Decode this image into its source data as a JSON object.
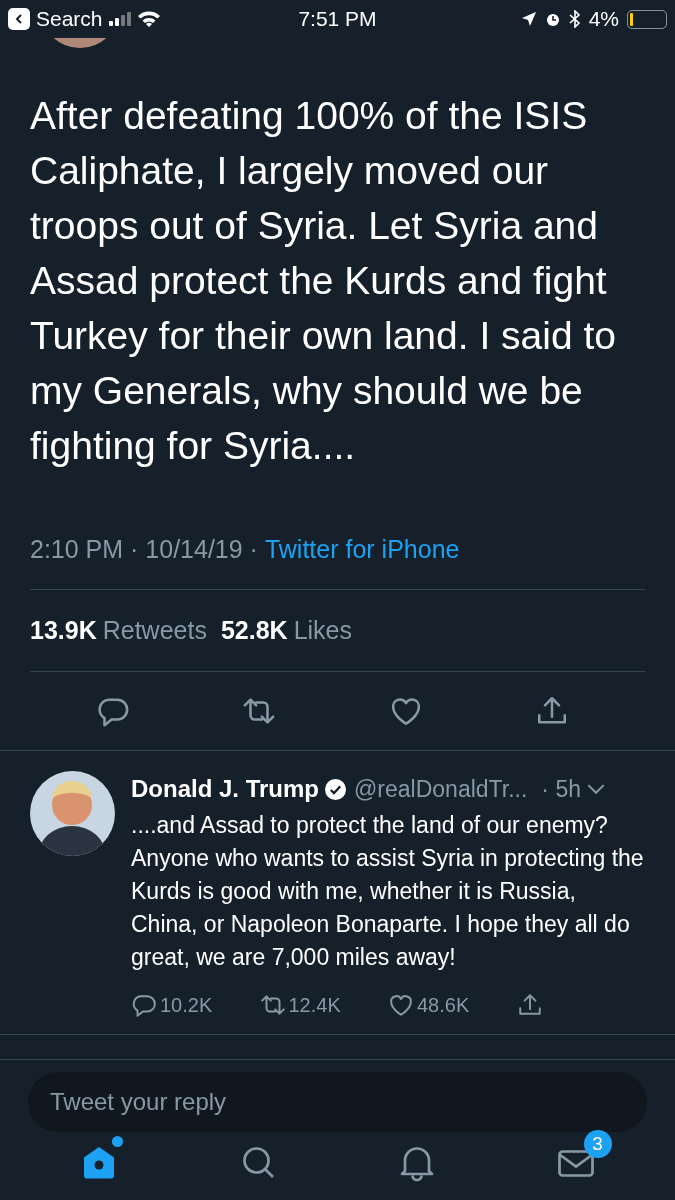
{
  "status_bar": {
    "back_label": "Search",
    "time": "7:51 PM",
    "battery": "4%"
  },
  "tweet": {
    "text": "After defeating 100% of the ISIS Caliphate, I largely moved our troops out of Syria. Let Syria and Assad protect the Kurds and fight Turkey for their own land. I said to my Generals, why should we be fighting for Syria....",
    "timestamp": "2:10 PM · 10/14/19 ·",
    "source": "Twitter for iPhone",
    "stats": [
      {
        "count": "13.9K",
        "label": "Retweets"
      },
      {
        "count": "52.8K",
        "label": "Likes"
      }
    ],
    "actions": [
      {
        "kind": "reply"
      },
      {
        "kind": "retweet"
      },
      {
        "kind": "like"
      },
      {
        "kind": "share"
      }
    ]
  },
  "reply": {
    "name": "Donald J. Trump",
    "verified": true,
    "handle": "@realDonaldTr...",
    "time": "· 5h",
    "text": "....and Assad to protect the land of our enemy? Anyone who wants to assist Syria in protecting the Kurds is good with me, whether it is Russia, China, or Napoleon Bonaparte. I hope they all do great, we are 7,000 miles away!",
    "actions": [
      {
        "kind": "reply",
        "count": "10.2K"
      },
      {
        "kind": "retweet",
        "count": "12.4K"
      },
      {
        "kind": "like",
        "count": "48.6K"
      },
      {
        "kind": "share"
      }
    ]
  },
  "composer": {
    "placeholder": "Tweet your reply"
  },
  "tabs": [
    {
      "kind": "home",
      "selected": true,
      "new_dot": true
    },
    {
      "kind": "search",
      "selected": false
    },
    {
      "kind": "notifications",
      "selected": false
    },
    {
      "kind": "messages",
      "selected": false,
      "badge": "3"
    }
  ]
}
